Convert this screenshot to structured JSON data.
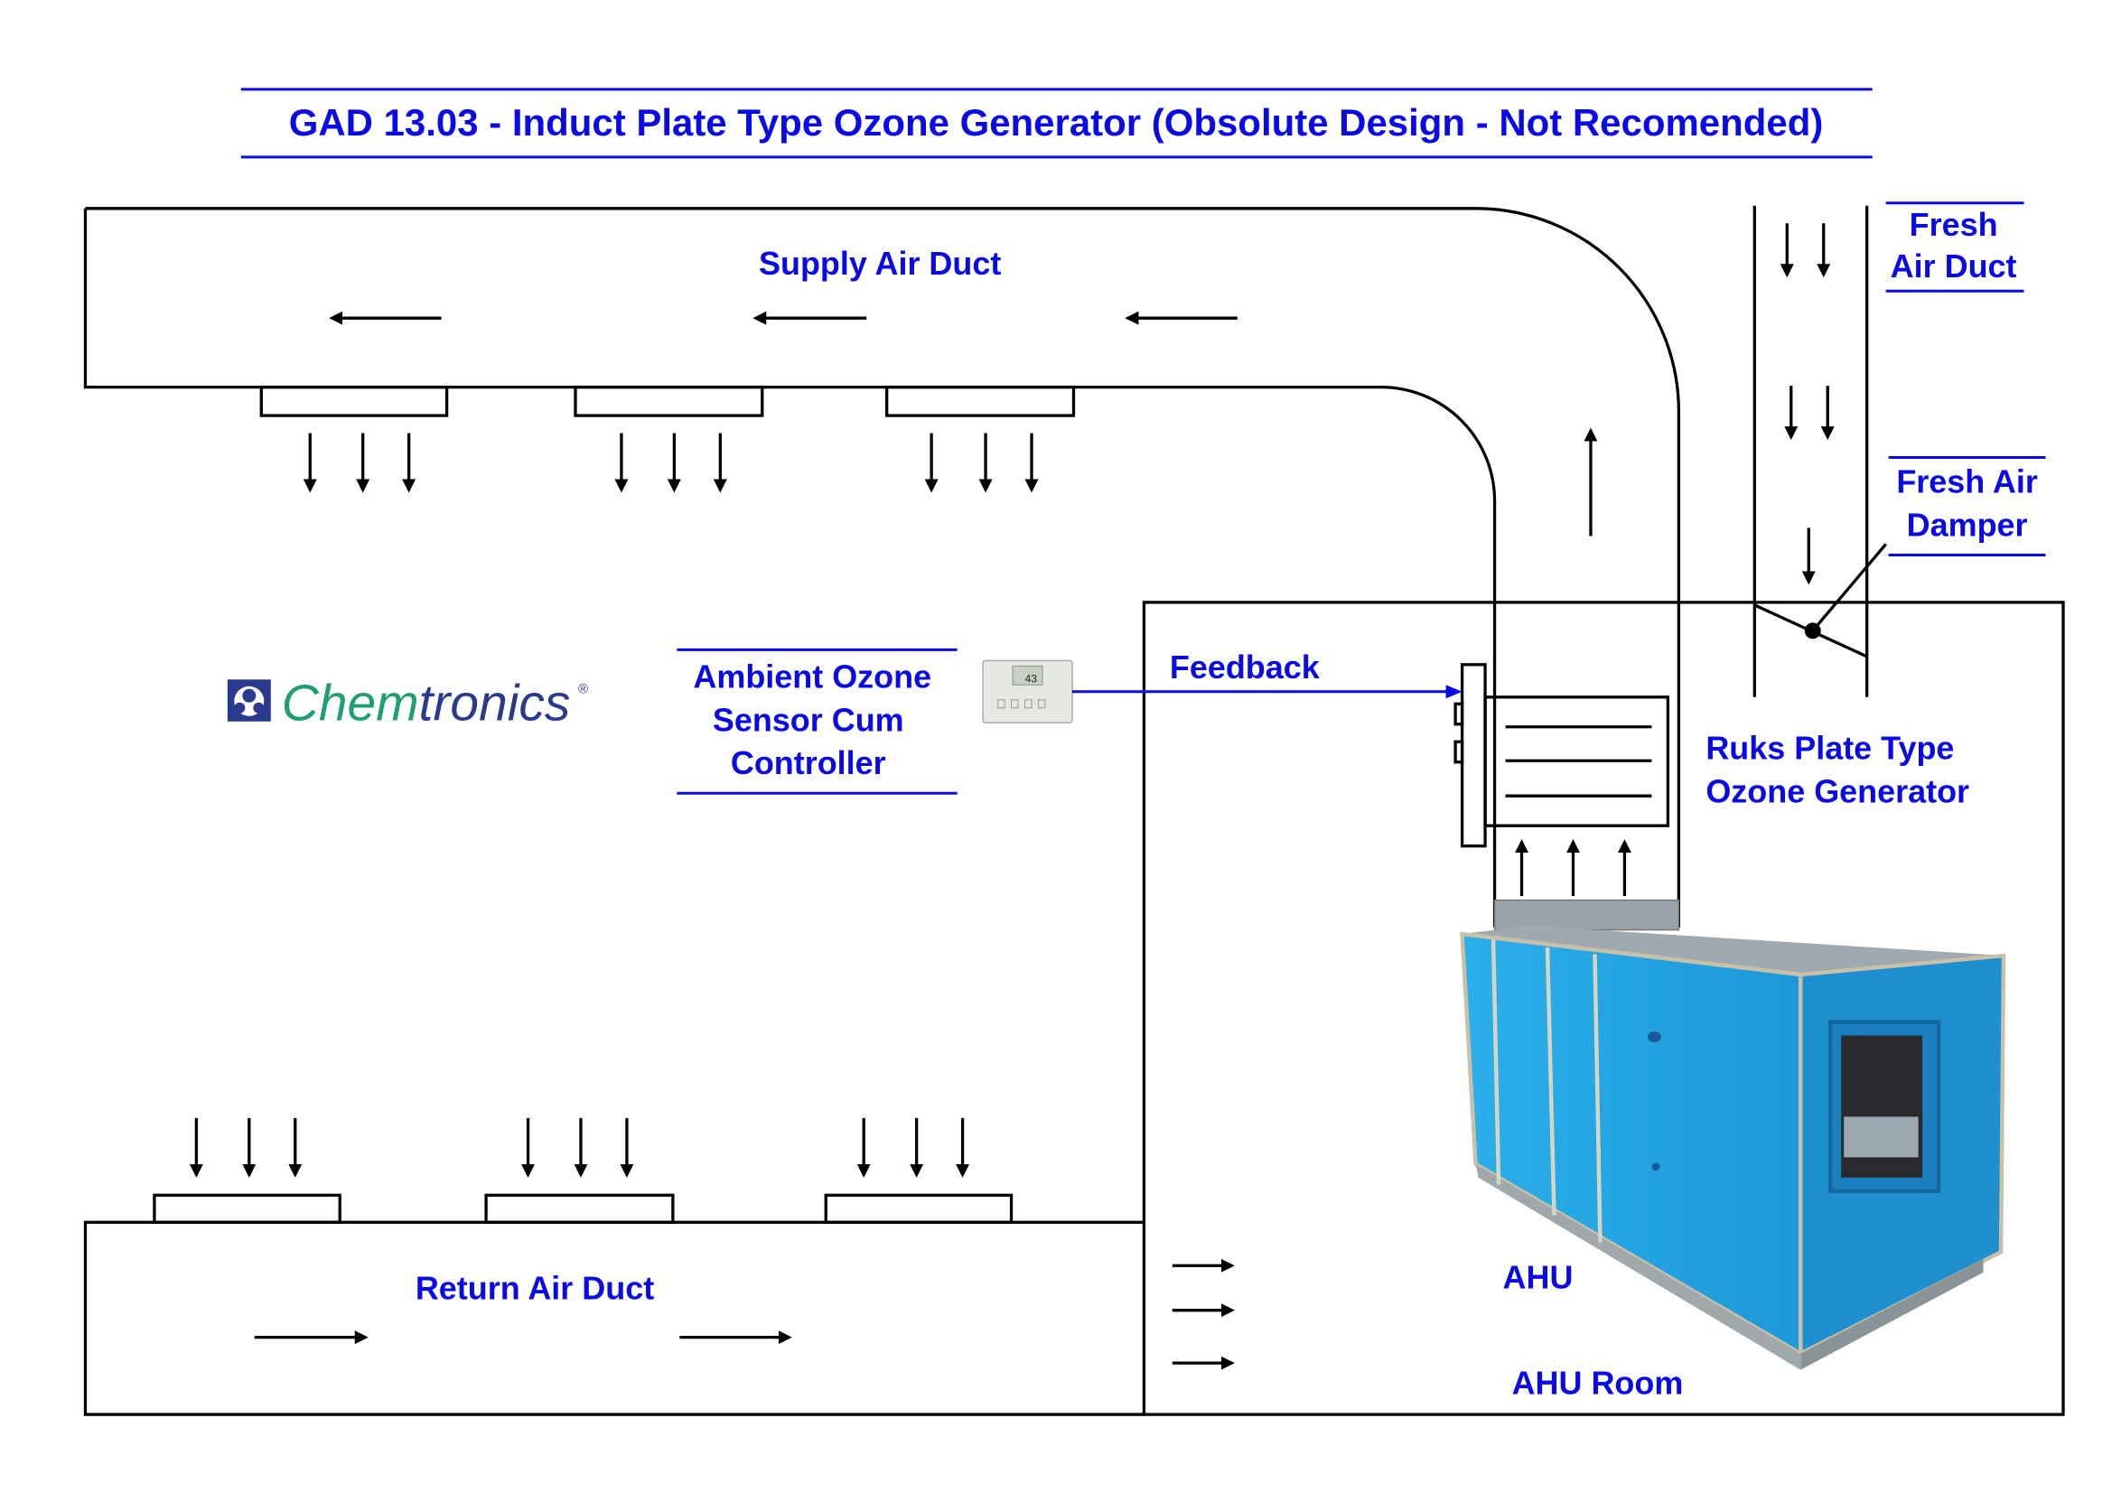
{
  "title": "GAD 13.03 - Induct Plate Type Ozone Generator (Obsolute Design - Not Recomended)",
  "labels": {
    "supply_air_duct": "Supply Air Duct",
    "return_air_duct": "Return Air Duct",
    "fresh_air_duct": [
      "Fresh",
      "Air Duct"
    ],
    "fresh_air_damper": [
      "Fresh Air",
      "Damper"
    ],
    "sensor": [
      "Ambient Ozone",
      "Sensor Cum",
      "Controller"
    ],
    "feedback": "Feedback",
    "ozone_generator": [
      "Ruks Plate Type",
      "Ozone Generator"
    ],
    "ahu": "AHU",
    "ahu_room": "AHU Room"
  },
  "logo": {
    "text_green": "Chem",
    "text_navy": "tronics",
    "mark": "®"
  },
  "controller_display": "43",
  "colors": {
    "label": "#0a0ae6",
    "ahu_panel": "#1fa3e0",
    "logo_green": "#1f9e6e",
    "logo_navy": "#2a3a8c"
  }
}
